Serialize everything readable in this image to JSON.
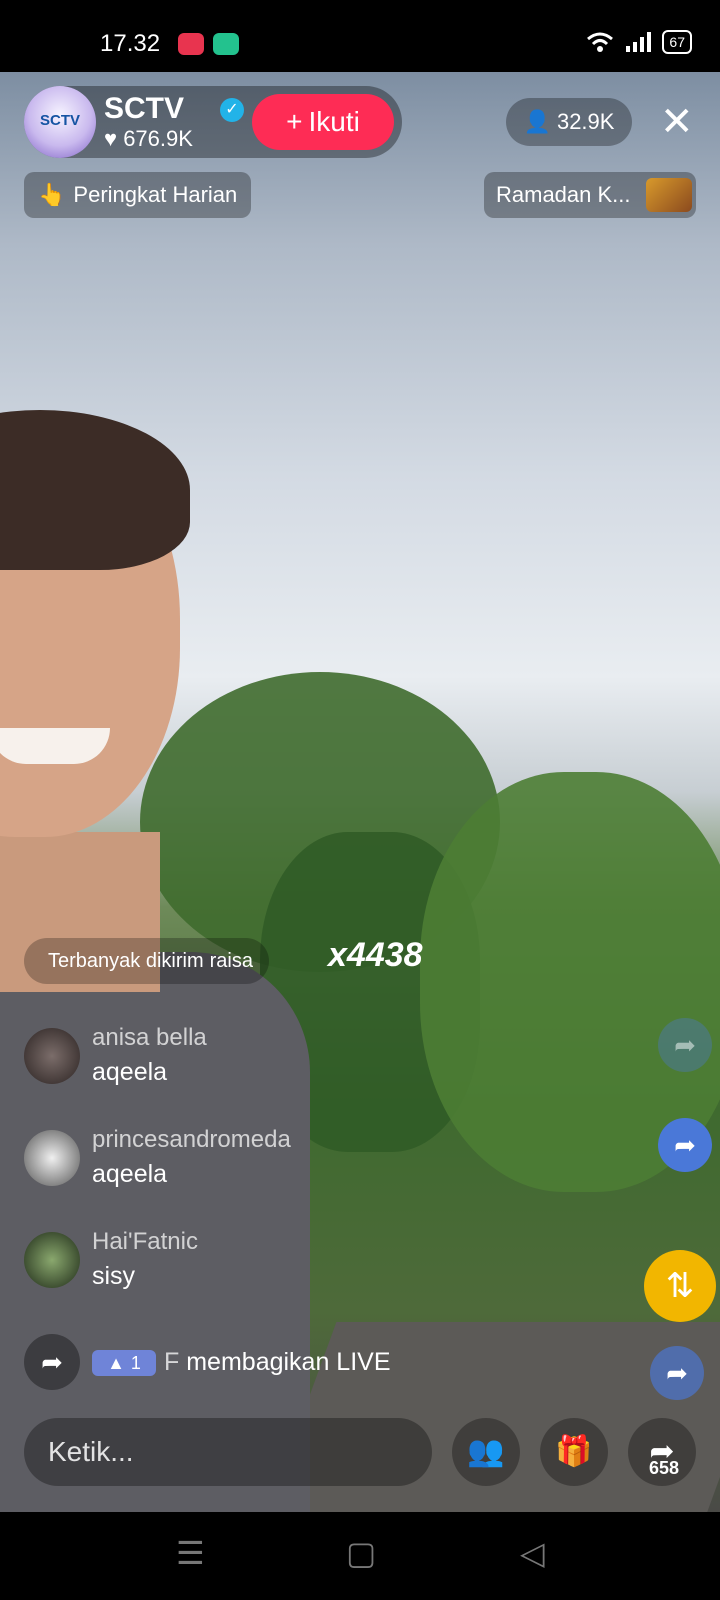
{
  "status_bar": {
    "time": "17.32",
    "battery": "67"
  },
  "host": {
    "name": "SCTV",
    "avatar_text": "SCTV",
    "likes": "676.9K",
    "follow_label": "Ikuti"
  },
  "viewer_count": "32.9K",
  "rank_pill": {
    "label": "Peringkat Harian"
  },
  "event_pill": {
    "label": "Ramadan K..."
  },
  "top_sender": {
    "prefix": "Terbanyak dikirim",
    "name": "raisa",
    "combo": "x4438"
  },
  "comments": [
    {
      "user": "anisa bella",
      "text": "aqeela"
    },
    {
      "user": "princesandromeda",
      "text": "aqeela"
    },
    {
      "user": "Hai'Fatnic",
      "text": "sisy"
    }
  ],
  "share_event": {
    "level": "1",
    "user": "F",
    "action": "membagikan LIVE"
  },
  "input": {
    "placeholder": "Ketik..."
  },
  "share_count": "658",
  "colors": {
    "follow": "#fe2c55",
    "repost": "#f2b600",
    "share_blue": "#4a78d8"
  }
}
